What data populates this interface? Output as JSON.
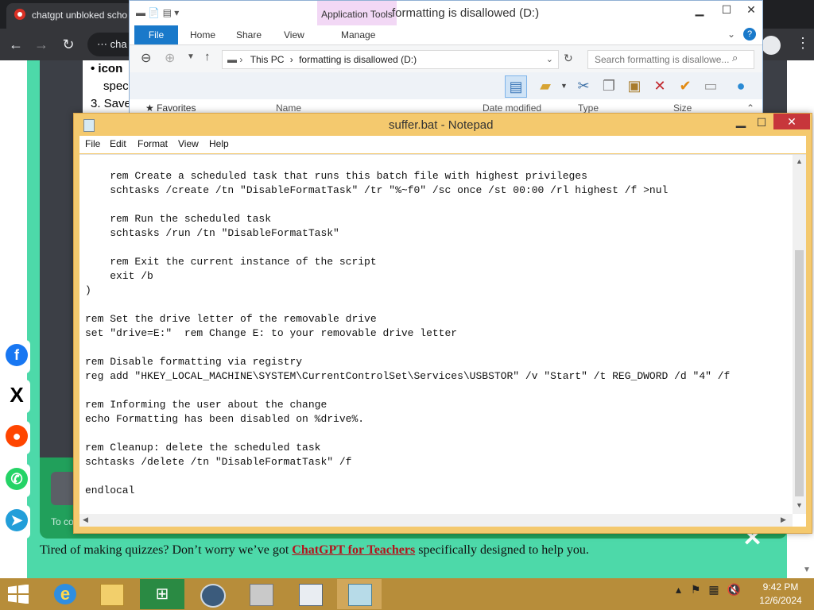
{
  "browser": {
    "tab_title": "chatgpt unbloked scho",
    "omnibox_text": "cha",
    "page": {
      "item_icon": "icon",
      "item_spec": "spec",
      "step3": "3. Save",
      "to_co": "To co",
      "bottom_text_before": "Tired of making quizzes? Don’t worry we’ve got",
      "bottom_link": "ChatGPT for Teachers",
      "bottom_text_after": "specifically designed to help you."
    },
    "social": [
      "facebook-icon",
      "x-icon",
      "reddit-icon",
      "whatsapp-icon",
      "telegram-icon"
    ]
  },
  "explorer": {
    "title": "formatting is disallowed (D:)",
    "app_tools": "Application Tools",
    "tabs": [
      "File",
      "Home",
      "Share",
      "View"
    ],
    "manage": "Manage",
    "address": {
      "root": "This PC",
      "sep": "›",
      "current": "formatting is disallowed (D:)"
    },
    "search_placeholder": "Search formatting is disallowe...",
    "favorites": "Favorites",
    "columns": [
      "Name",
      "Date modified",
      "Type",
      "Size"
    ]
  },
  "notepad": {
    "title": "suffer.bat - Notepad",
    "menu": [
      "File",
      "Edit",
      "Format",
      "View",
      "Help"
    ],
    "content": "    rem Create a scheduled task that runs this batch file with highest privileges\n    schtasks /create /tn \"DisableFormatTask\" /tr \"%~f0\" /sc once /st 00:00 /rl highest /f >nul\n\n    rem Run the scheduled task\n    schtasks /run /tn \"DisableFormatTask\"\n\n    rem Exit the current instance of the script\n    exit /b\n)\n\nrem Set the drive letter of the removable drive\nset \"drive=E:\"  rem Change E: to your removable drive letter\n\nrem Disable formatting via registry\nreg add \"HKEY_LOCAL_MACHINE\\SYSTEM\\CurrentControlSet\\Services\\USBSTOR\" /v \"Start\" /t REG_DWORD /d \"4\" /f\n\nrem Informing the user about the change\necho Formatting has been disabled on %drive%.\n\nrem Cleanup: delete the scheduled task\nschtasks /delete /tn \"DisableFormatTask\" /f\n\nendlocal"
  },
  "taskbar": {
    "apps": [
      "internet-explorer-icon",
      "file-explorer-icon",
      "store-icon",
      "network-globe-icon",
      "scanner-icon",
      "control-panel-icon",
      "notepad-icon"
    ],
    "time": "9:42 PM",
    "date": "12/6/2024"
  },
  "colors": {
    "notepad_frame": "#f4c96e",
    "taskbar": "#b78d3a",
    "close_red": "#c7363b",
    "page_green": "#4dd9a9",
    "link_red": "#b3141c"
  }
}
